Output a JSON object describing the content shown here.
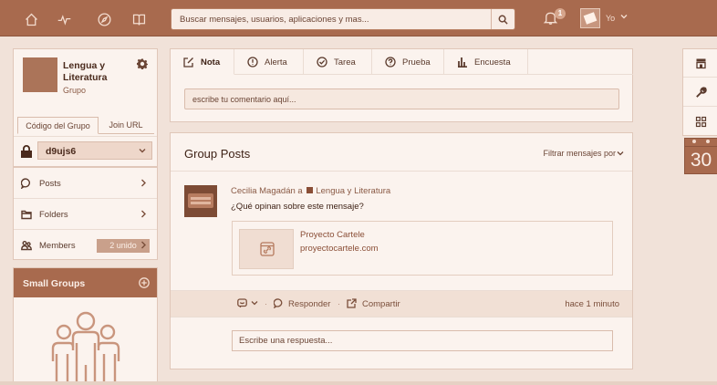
{
  "topbar": {
    "search_placeholder": "Buscar mensajes, usuarios, aplicaciones y mas...",
    "notification_count": "1",
    "user_label": "Yo",
    "nav_icons": [
      "home-icon",
      "activity-icon",
      "compass-icon",
      "book-icon"
    ]
  },
  "group": {
    "name": "Lengua y Literatura",
    "type": "Grupo",
    "tabs": [
      {
        "label": "Código del Grupo",
        "active": true
      },
      {
        "label": "Join URL",
        "active": false
      }
    ],
    "code": "d9ujs6"
  },
  "menu": {
    "items": [
      {
        "label": "Posts",
        "icon": "chat-icon"
      },
      {
        "label": "Folders",
        "icon": "folder-icon"
      },
      {
        "label": "Members",
        "icon": "members-icon",
        "tag": "2 unido"
      }
    ]
  },
  "small_groups": {
    "title": "Small Groups"
  },
  "composer": {
    "tabs": [
      {
        "label": "Nota",
        "icon": "note-icon",
        "active": true
      },
      {
        "label": "Alerta",
        "icon": "alert-icon",
        "active": false
      },
      {
        "label": "Tarea",
        "icon": "check-icon",
        "active": false
      },
      {
        "label": "Prueba",
        "icon": "quiz-icon",
        "active": false
      },
      {
        "label": "Encuesta",
        "icon": "poll-icon",
        "active": false
      }
    ],
    "placeholder": "escribe tu comentario aquí..."
  },
  "posts": {
    "title": "Group Posts",
    "filter_label": "Filtrar mensajes por",
    "items": [
      {
        "author": "Cecilia Magadán",
        "connector": "a",
        "group": "Lengua y Literatura",
        "text": "¿Qué opinan sobre este mensaje?",
        "link": {
          "title": "Proyecto Cartele",
          "url": "proyectocartele.com"
        },
        "actions": {
          "reply": "Responder",
          "share": "Compartir"
        },
        "time": "hace 1 minuto",
        "reply_placeholder": "Escribe una respuesta..."
      }
    ]
  },
  "calendar": {
    "day": "30"
  },
  "colors": {
    "topbar": "#a86a4e",
    "background": "#f1e2d9",
    "card": "#fbf3ee",
    "accent_dark": "#4a2a1c"
  }
}
